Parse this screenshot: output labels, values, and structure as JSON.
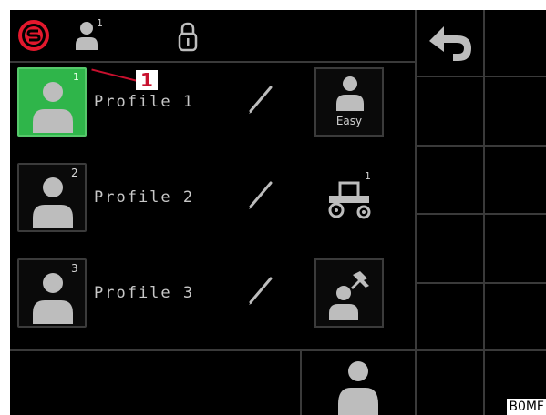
{
  "header": {
    "icons": [
      "brand-logo-icon",
      "user-status-icon",
      "lock-icon"
    ],
    "user_badge": "1"
  },
  "profiles": [
    {
      "label": "Profile 1",
      "number": "1",
      "active": true,
      "mode_icon": "easy-user-icon",
      "mode_label": "Easy"
    },
    {
      "label": "Profile 2",
      "number": "2",
      "active": false,
      "mode_icon": "tractor-icon",
      "mode_badge": "1"
    },
    {
      "label": "Profile 3",
      "number": "3",
      "active": false,
      "mode_icon": "user-pin-icon"
    }
  ],
  "callout": {
    "number": "1"
  },
  "side_panel": {
    "back_icon": "back-arrow-icon"
  },
  "footer": {
    "user_icon": "user-icon"
  },
  "figure_ref": "B0MF",
  "colors": {
    "accent_red": "#e3182d",
    "active_green": "#2fb54a",
    "icon_gray": "#bdbdbd",
    "background": "#000000"
  }
}
